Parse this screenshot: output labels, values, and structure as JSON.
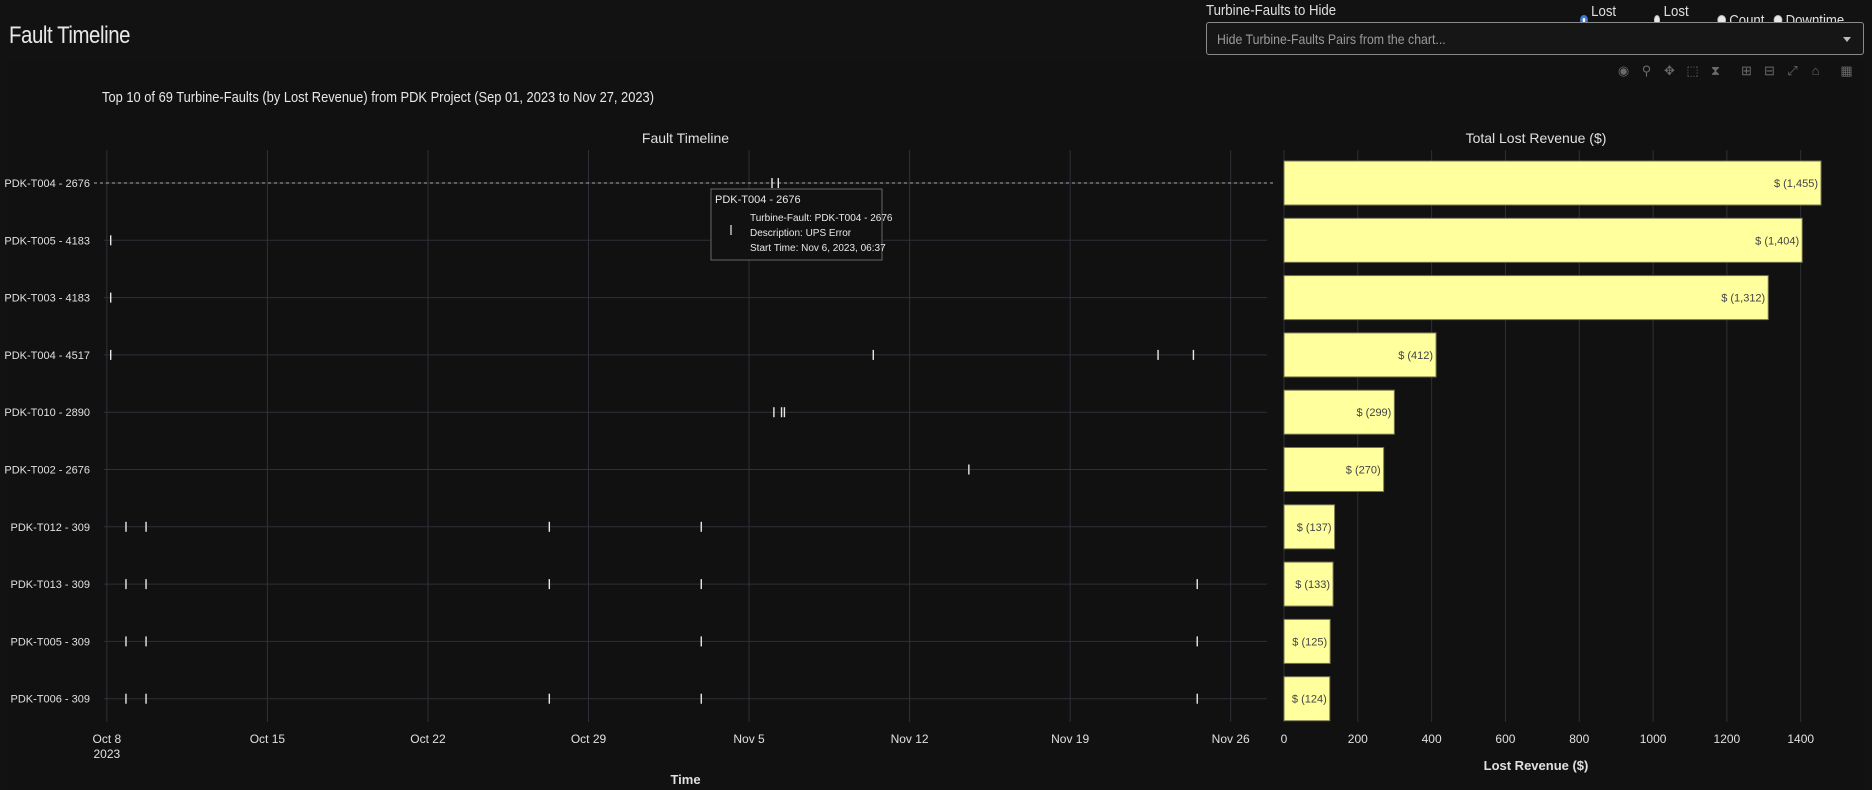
{
  "page": {
    "title": "Fault Timeline"
  },
  "controls": {
    "hide_label": "Turbine-Faults to Hide",
    "hide_placeholder": "Hide Turbine-Faults Pairs from the chart...",
    "metric_options": [
      {
        "label": "Lost Revenue",
        "selected": true
      },
      {
        "label": "Lost Energy",
        "selected": false
      },
      {
        "label": "Count",
        "selected": false
      },
      {
        "label": "Downtime",
        "selected": false
      }
    ]
  },
  "modebar": [
    "camera-icon",
    "zoom-icon",
    "pan-icon",
    "box-select-icon",
    "lasso-icon",
    "zoom-in-icon",
    "zoom-out-icon",
    "autoscale-icon",
    "home-icon",
    "plotly-logo-icon"
  ],
  "chart_data": {
    "type": "bar",
    "title": "Top 10 of 69 Turbine-Faults (by Lost Revenue) from PDK Project (Sep 01, 2023 to Nov 27, 2023)",
    "colors": {
      "bar": "#ffff9e",
      "bar_edge": "#777755",
      "grid": "#2e3138",
      "text": "#e0e0e0",
      "marker": "#e8e8e8"
    },
    "categories": [
      "PDK-T004 - 2676",
      "PDK-T005 - 4183",
      "PDK-T003 - 4183",
      "PDK-T004 - 4517",
      "PDK-T010 - 2890",
      "PDK-T002 - 2676",
      "PDK-T012 - 309",
      "PDK-T013 - 309",
      "PDK-T005 - 309",
      "PDK-T006 - 309"
    ],
    "timeline": {
      "subtitle": "Fault Timeline",
      "xlabel": "Time",
      "x_range": [
        "2023-10-07T21:00",
        "2023-11-27T14:00"
      ],
      "ticks": [
        {
          "date": "2023-10-08",
          "label": "Oct 8",
          "sublabel": "2023"
        },
        {
          "date": "2023-10-15",
          "label": "Oct 15",
          "sublabel": ""
        },
        {
          "date": "2023-10-22",
          "label": "Oct 22",
          "sublabel": ""
        },
        {
          "date": "2023-10-29",
          "label": "Oct 29",
          "sublabel": ""
        },
        {
          "date": "2023-11-05",
          "label": "Nov 5",
          "sublabel": ""
        },
        {
          "date": "2023-11-12",
          "label": "Nov 12",
          "sublabel": ""
        },
        {
          "date": "2023-11-19",
          "label": "Nov 19",
          "sublabel": ""
        },
        {
          "date": "2023-11-26",
          "label": "Nov 26",
          "sublabel": ""
        }
      ],
      "events": [
        {
          "row": 0,
          "t": [
            "2023-11-06T00:00",
            "2023-11-06T06:37"
          ]
        },
        {
          "row": 1,
          "t": [
            "2023-10-08T04:00"
          ]
        },
        {
          "row": 2,
          "t": [
            "2023-10-08T04:00"
          ]
        },
        {
          "row": 3,
          "t": [
            "2023-10-08T04:00",
            "2023-11-10T10:00",
            "2023-11-22T20:00",
            "2023-11-24T09:00"
          ]
        },
        {
          "row": 4,
          "t": [
            "2023-11-06T02:00",
            "2023-11-06T10:00",
            "2023-11-06T13:00"
          ]
        },
        {
          "row": 5,
          "t": [
            "2023-11-14T14:00"
          ]
        },
        {
          "row": 6,
          "t": [
            "2023-10-08T20:00",
            "2023-10-09T17:00",
            "2023-10-27T07:00",
            "2023-11-02T22:00"
          ]
        },
        {
          "row": 7,
          "t": [
            "2023-10-08T20:00",
            "2023-10-09T17:00",
            "2023-10-27T07:00",
            "2023-11-02T22:00",
            "2023-11-24T13:00"
          ]
        },
        {
          "row": 8,
          "t": [
            "2023-10-08T20:00",
            "2023-10-09T17:00",
            "2023-11-02T22:00",
            "2023-11-24T13:00"
          ]
        },
        {
          "row": 9,
          "t": [
            "2023-10-08T20:00",
            "2023-10-09T17:00",
            "2023-10-27T07:00",
            "2023-11-02T22:00",
            "2023-11-24T13:00"
          ]
        }
      ],
      "hover": {
        "title": "PDK-T004 - 2676",
        "lines": [
          "Turbine-Fault: PDK-T004 - 2676",
          "Description: UPS Error",
          "Start Time: Nov 6, 2023, 06:37"
        ]
      }
    },
    "revenue": {
      "subtitle": "Total Lost Revenue ($)",
      "xlabel": "Lost Revenue ($)",
      "xlim": [
        0,
        1520
      ],
      "ticks": [
        0,
        200,
        400,
        600,
        800,
        1000,
        1200,
        1400
      ],
      "values": [
        1455,
        1404,
        1312,
        412,
        299,
        270,
        137,
        133,
        125,
        124
      ],
      "labels": [
        "$ (1,455)",
        "$ (1,404)",
        "$ (1,312)",
        "$ (412)",
        "$ (299)",
        "$ (270)",
        "$ (137)",
        "$ (133)",
        "$ (125)",
        "$ (124)"
      ]
    }
  }
}
